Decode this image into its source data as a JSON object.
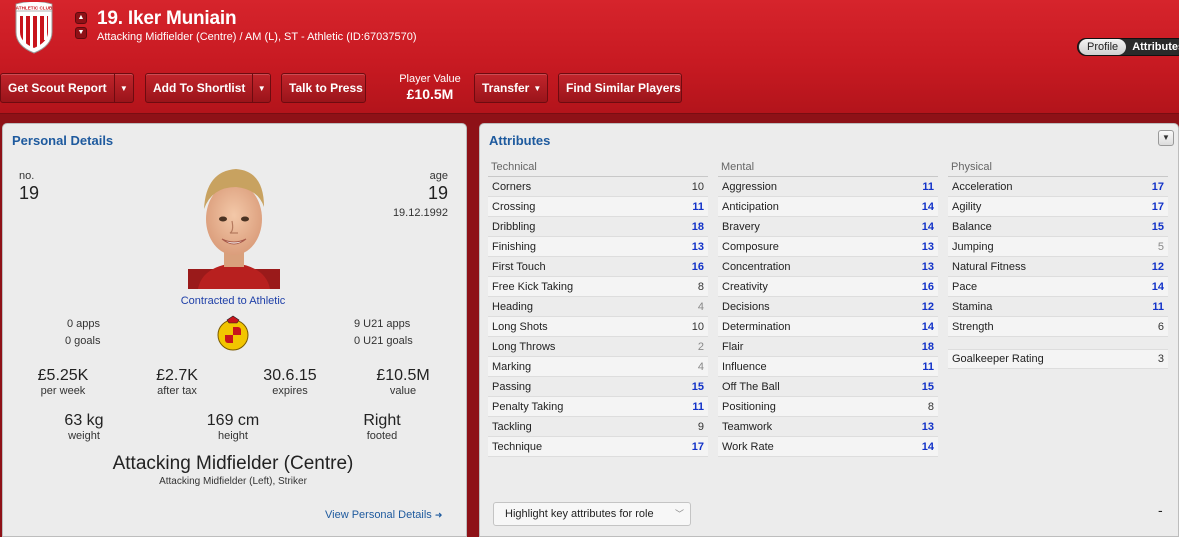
{
  "header": {
    "player_name": "19. Iker Muniain",
    "player_sub": "Attacking Midfielder (Centre) / AM (L), ST - Athletic (ID:67037570)",
    "toggle_profile": "Profile",
    "toggle_attributes": "Attributes",
    "crest_text": "ATHLETIC CLUB"
  },
  "toolbar": {
    "scout_report": "Get Scout Report",
    "shortlist": "Add To Shortlist",
    "talk_press": "Talk to Press",
    "player_value_label": "Player Value",
    "player_value": "£10.5M",
    "transfer": "Transfer",
    "find_similar": "Find Similar Players"
  },
  "personal": {
    "title": "Personal Details",
    "no_label": "no.",
    "no_value": "19",
    "age_label": "age",
    "age_value": "19",
    "dob": "19.12.1992",
    "contract": "Contracted to Athletic",
    "apps": "0 apps",
    "goals": "0 goals",
    "u21_apps": "9 U21 apps",
    "u21_goals": "0 U21 goals",
    "wage": "£5.25K",
    "wage_label": "per week",
    "after_tax": "£2.7K",
    "after_tax_label": "after tax",
    "expires": "30.6.15",
    "expires_label": "expires",
    "value": "£10.5M",
    "value_label": "value",
    "weight": "63 kg",
    "weight_label": "weight",
    "height": "169 cm",
    "height_label": "height",
    "footed": "Right",
    "footed_label": "footed",
    "position": "Attacking Midfielder (Centre)",
    "positions_other": "Attacking Midfielder (Left), Striker",
    "view_link": "View Personal Details"
  },
  "attributes": {
    "title": "Attributes",
    "highlight_label": "Highlight key attributes for role",
    "collapse_glyph": "-",
    "technical": {
      "heading": "Technical",
      "rows": [
        {
          "name": "Corners",
          "value": "10"
        },
        {
          "name": "Crossing",
          "value": "11"
        },
        {
          "name": "Dribbling",
          "value": "18"
        },
        {
          "name": "Finishing",
          "value": "13"
        },
        {
          "name": "First Touch",
          "value": "16"
        },
        {
          "name": "Free Kick Taking",
          "value": "8"
        },
        {
          "name": "Heading",
          "value": "4"
        },
        {
          "name": "Long Shots",
          "value": "10"
        },
        {
          "name": "Long Throws",
          "value": "2"
        },
        {
          "name": "Marking",
          "value": "4"
        },
        {
          "name": "Passing",
          "value": "15"
        },
        {
          "name": "Penalty Taking",
          "value": "11"
        },
        {
          "name": "Tackling",
          "value": "9"
        },
        {
          "name": "Technique",
          "value": "17"
        }
      ]
    },
    "mental": {
      "heading": "Mental",
      "rows": [
        {
          "name": "Aggression",
          "value": "11"
        },
        {
          "name": "Anticipation",
          "value": "14"
        },
        {
          "name": "Bravery",
          "value": "14"
        },
        {
          "name": "Composure",
          "value": "13"
        },
        {
          "name": "Concentration",
          "value": "13"
        },
        {
          "name": "Creativity",
          "value": "16"
        },
        {
          "name": "Decisions",
          "value": "12"
        },
        {
          "name": "Determination",
          "value": "14"
        },
        {
          "name": "Flair",
          "value": "18"
        },
        {
          "name": "Influence",
          "value": "11"
        },
        {
          "name": "Off The Ball",
          "value": "15"
        },
        {
          "name": "Positioning",
          "value": "8"
        },
        {
          "name": "Teamwork",
          "value": "13"
        },
        {
          "name": "Work Rate",
          "value": "14"
        }
      ]
    },
    "physical": {
      "heading": "Physical",
      "rows": [
        {
          "name": "Acceleration",
          "value": "17"
        },
        {
          "name": "Agility",
          "value": "17"
        },
        {
          "name": "Balance",
          "value": "15"
        },
        {
          "name": "Jumping",
          "value": "5"
        },
        {
          "name": "Natural Fitness",
          "value": "12"
        },
        {
          "name": "Pace",
          "value": "14"
        },
        {
          "name": "Stamina",
          "value": "11"
        },
        {
          "name": "Strength",
          "value": "6"
        }
      ],
      "gk_label": "Goalkeeper Rating",
      "gk_value": "3"
    }
  },
  "colors": {
    "header_red": "#c81a22",
    "accent_blue": "#1e5a9e",
    "highlight_value": "#1232c8"
  }
}
